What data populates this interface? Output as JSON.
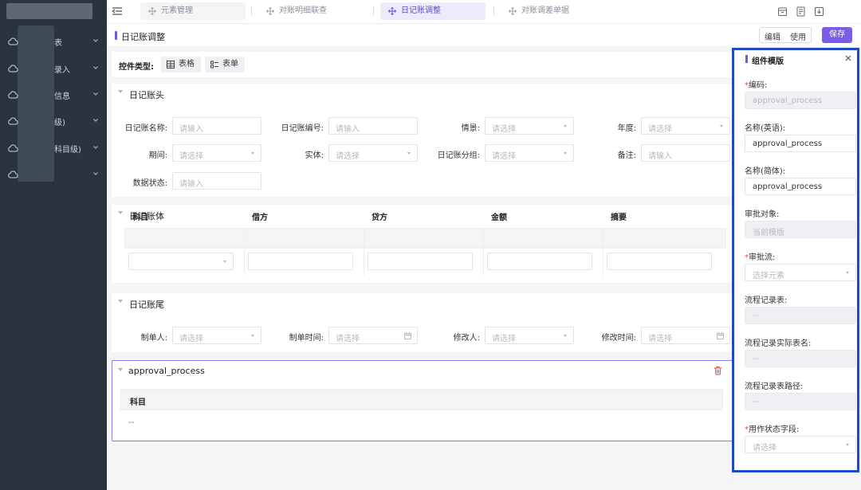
{
  "sidebar": {
    "items": [
      {
        "label": "表",
        "icon": "cloud-icon"
      },
      {
        "label": "录入",
        "icon": "cloud-icon"
      },
      {
        "label": "信息",
        "icon": "cloud-icon"
      },
      {
        "label": "级)",
        "icon": "cloud-icon"
      },
      {
        "label": "科目级)",
        "icon": "cloud-icon"
      },
      {
        "label": "",
        "icon": "cloud-icon"
      }
    ]
  },
  "tabs": [
    {
      "label": "元素管理",
      "state": "inactive"
    },
    {
      "label": "对账明细联查",
      "state": "plain"
    },
    {
      "label": "日记账调整",
      "state": "active"
    },
    {
      "label": "对账调差单据",
      "state": "plain"
    }
  ],
  "page": {
    "title": "日记账调整",
    "mode_edit": "编辑",
    "mode_use": "使用",
    "save": "保存"
  },
  "control_type": {
    "label": "控件类型:",
    "table": "表格",
    "form": "表单"
  },
  "header_section": {
    "title": "日记账头",
    "fields": [
      {
        "label": "日记账名称:",
        "placeholder": "请输入",
        "kind": "input"
      },
      {
        "label": "日记账编号:",
        "placeholder": "请输入",
        "kind": "input"
      },
      {
        "label": "情景:",
        "placeholder": "请选择",
        "kind": "select"
      },
      {
        "label": "年度:",
        "placeholder": "请选择",
        "kind": "select"
      },
      {
        "label": "期间:",
        "placeholder": "请选择",
        "kind": "select"
      },
      {
        "label": "实体:",
        "placeholder": "请选择",
        "kind": "select"
      },
      {
        "label": "日记账分组:",
        "placeholder": "请选择",
        "kind": "select"
      },
      {
        "label": "备注:",
        "placeholder": "请输入",
        "kind": "input"
      },
      {
        "label": "数据状态:",
        "placeholder": "请输入",
        "kind": "input"
      }
    ]
  },
  "body_section": {
    "title": "日记账体",
    "columns": [
      "科目",
      "借方",
      "贷方",
      "金额",
      "摘要"
    ]
  },
  "footer_section": {
    "title": "日记账尾",
    "fields": [
      {
        "label": "制单人:",
        "placeholder": "请选择",
        "kind": "select"
      },
      {
        "label": "制单时间:",
        "placeholder": "请选择",
        "kind": "date"
      },
      {
        "label": "修改人:",
        "placeholder": "请选择",
        "kind": "select"
      },
      {
        "label": "修改时间:",
        "placeholder": "请选择",
        "kind": "date"
      }
    ]
  },
  "approval": {
    "title": "approval_process",
    "column": "科目",
    "cell": "--"
  },
  "panel": {
    "title": "组件模版",
    "fields": [
      {
        "label": "编码:",
        "required": true,
        "value": "approval_process",
        "kind": "disabled"
      },
      {
        "label": "名称(英语):",
        "required": false,
        "value": "approval_process",
        "kind": "normal"
      },
      {
        "label": "名称(简体):",
        "required": false,
        "value": "approval_process",
        "kind": "normal"
      },
      {
        "label": "审批对象:",
        "required": false,
        "value": "当前模版",
        "kind": "disabled"
      },
      {
        "label": "审批流:",
        "required": true,
        "value": "选择元素",
        "kind": "select"
      },
      {
        "label": "流程记录表:",
        "required": false,
        "value": "--",
        "kind": "disabled"
      },
      {
        "label": "流程记录实际表名:",
        "required": false,
        "value": "--",
        "kind": "disabled"
      },
      {
        "label": "流程记录表路径:",
        "required": false,
        "value": "--",
        "kind": "disabled"
      },
      {
        "label": "用作状态字段:",
        "required": true,
        "value": "请选择",
        "kind": "select"
      }
    ]
  },
  "colors": {
    "accent": "#7b5ce6",
    "sidebar_bg": "#2b343e",
    "highlight_border": "#1e49c8"
  }
}
